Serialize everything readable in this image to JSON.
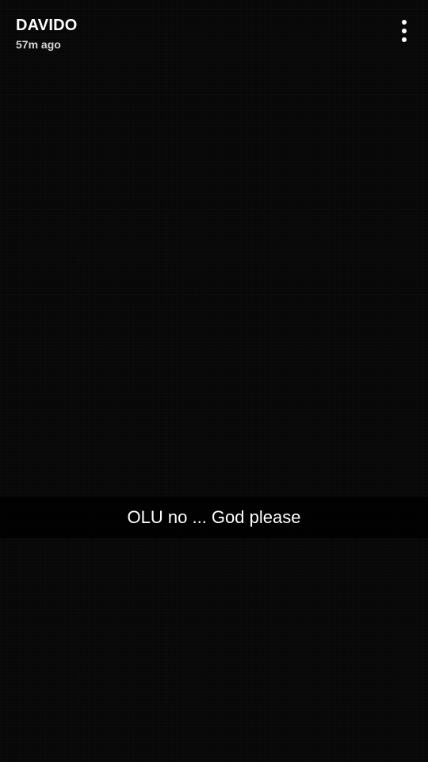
{
  "story": {
    "username": "DAVIDO",
    "timestamp": "57m ago",
    "caption": "OLU no ... God please"
  },
  "icons": {
    "more": "more-vertical-icon"
  }
}
